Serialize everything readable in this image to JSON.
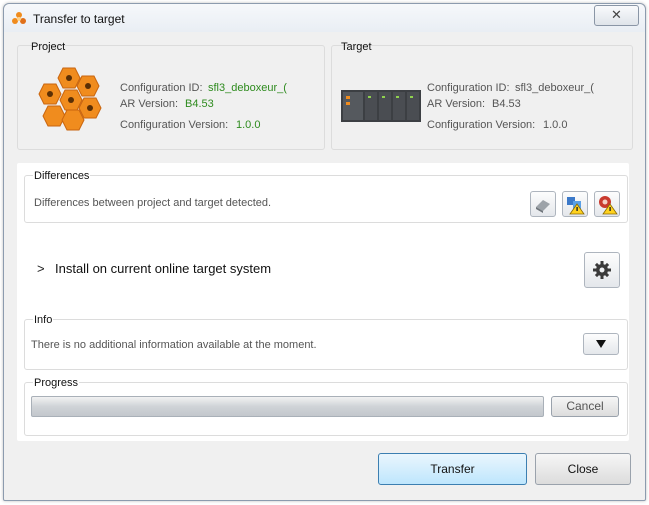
{
  "window": {
    "title": "Transfer to target",
    "close_glyph": "✕"
  },
  "project": {
    "label": "Project",
    "config_id_label": "Configuration ID:",
    "config_id_value": "sfl3_deboxeur_(",
    "ar_label": "AR Version:",
    "ar_value": "B4.53",
    "config_ver_label": "Configuration Version:",
    "config_ver_value": "1.0.0"
  },
  "target": {
    "label": "Target",
    "config_id_label": "Configuration ID:",
    "config_id_value": "sfl3_deboxeur_(",
    "ar_label": "AR Version:",
    "ar_value": "B4.53",
    "config_ver_label": "Configuration Version:",
    "config_ver_value": "1.0.0"
  },
  "differences": {
    "label": "Differences",
    "message": "Differences between project and target detected.",
    "icons": [
      "hardware-diff-icon",
      "software-warning-icon",
      "config-warning-icon"
    ]
  },
  "install": {
    "chevron": ">",
    "text": "Install on current online target system",
    "settings_icon": "gear-icon"
  },
  "info": {
    "label": "Info",
    "message": "There is no additional information available at the moment.",
    "toggle_icon": "triangle-down-icon"
  },
  "progress": {
    "label": "Progress",
    "value": 0,
    "cancel_label": "Cancel"
  },
  "buttons": {
    "transfer_label": "Transfer",
    "close_label": "Close"
  },
  "colors": {
    "accent_orange": "#f08c1e",
    "value_green": "#2e8b1e",
    "primary_border": "#3c7fb1"
  }
}
